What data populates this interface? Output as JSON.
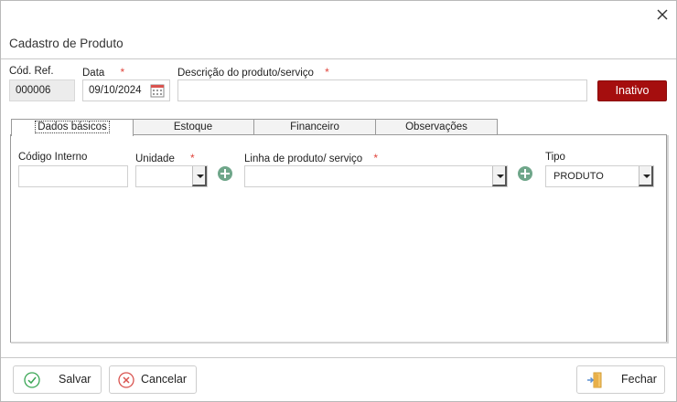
{
  "dialog": {
    "title": "Cadastro de Produto"
  },
  "header_fields": {
    "cod_ref": {
      "label": "Cód. Ref.",
      "value": "000006"
    },
    "data": {
      "label": "Data",
      "value": "09/10/2024",
      "required_mark": "*"
    },
    "descricao": {
      "label": "Descrição do produto/serviço",
      "value": "",
      "required_mark": "*"
    },
    "status_button": "Inativo"
  },
  "tabs": [
    {
      "label": "Dados básicos",
      "active": true
    },
    {
      "label": "Estoque",
      "active": false
    },
    {
      "label": "Financeiro",
      "active": false
    },
    {
      "label": "Observações",
      "active": false
    }
  ],
  "dados_basicos": {
    "codigo_interno": {
      "label": "Código Interno",
      "value": ""
    },
    "unidade": {
      "label": "Unidade",
      "value": "",
      "required_mark": "*"
    },
    "linha": {
      "label": "Linha de produto/ serviço",
      "value": "",
      "required_mark": "*"
    },
    "tipo": {
      "label": "Tipo",
      "value": "PRODUTO"
    }
  },
  "footer": {
    "salvar": "Salvar",
    "cancelar": "Cancelar",
    "fechar": "Fechar"
  },
  "colors": {
    "inativo_bg": "#a50e0e",
    "required": "#e0443b",
    "add_icon": "#6fa68a",
    "save_icon": "#3aa655",
    "cancel_icon": "#d9534f",
    "close_door_icon": "#e8b04a"
  },
  "icons": {
    "close": "close-icon",
    "calendar": "calendar-icon",
    "add": "add-icon",
    "save": "check-circle-icon",
    "cancel": "x-circle-icon",
    "fechar": "door-exit-icon"
  }
}
